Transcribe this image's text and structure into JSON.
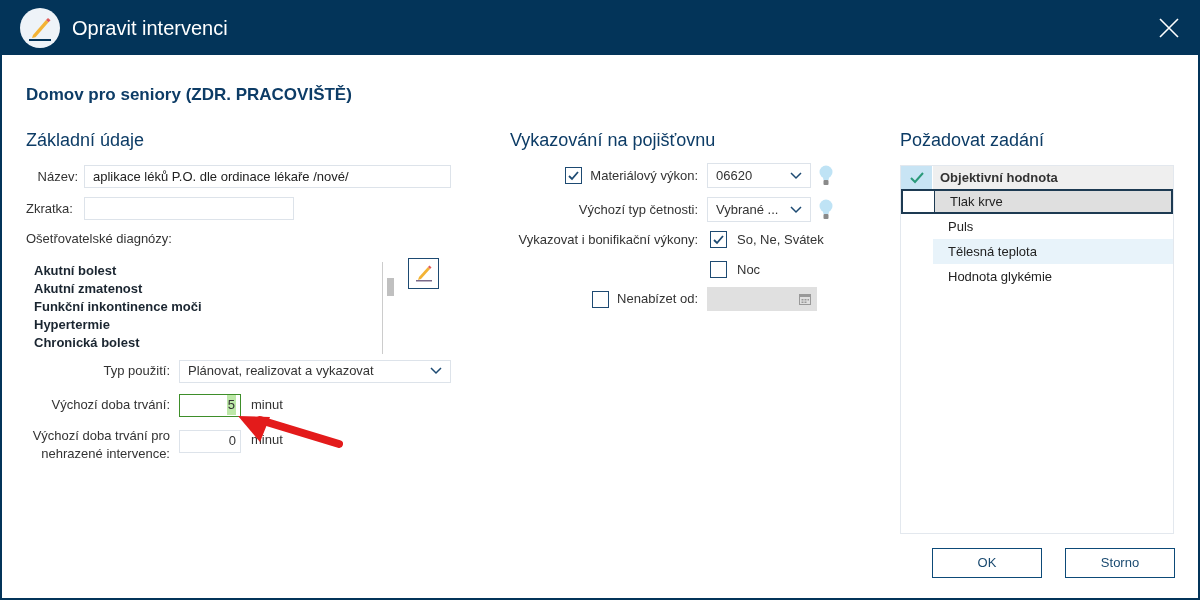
{
  "window": {
    "title": "Opravit intervenci"
  },
  "heading": "Domov pro seniory (ZDR. PRACOVIŠTĚ)",
  "basic": {
    "title": "Základní údaje",
    "name": {
      "label": "Název:",
      "value": "aplikace léků P.O. dle ordinace lékaře /nové/"
    },
    "abbrev": {
      "label": "Zkratka:"
    },
    "diagnoses_label": "Ošetřovatelské diagnózy:",
    "diagnoses": [
      "Akutní bolest",
      "Akutní zmatenost",
      "Funkční inkontinence moči",
      "Hypertermie",
      "Chronická bolest"
    ],
    "usage": {
      "label": "Typ použití:",
      "value": "Plánovat, realizovat a vykazovat"
    },
    "duration": {
      "label": "Výchozí doba trvání:",
      "value": "5",
      "unit": "minut",
      "focused": true
    },
    "duration_unpaid": {
      "label": "Výchozí doba trvání pro nehrazené intervence:",
      "value": "0",
      "unit": "minut",
      "focused": false
    }
  },
  "insurance": {
    "title": "Vykazování na pojišťovnu",
    "material": {
      "checked": true,
      "label": "Materiálový výkon:",
      "value": "06620"
    },
    "frequency": {
      "label": "Výchozí typ četnosti:",
      "value": "Vybrané ..."
    },
    "bonus_label": "Vykazovat i bonifikační výkony:",
    "bonus": [
      {
        "label": "So, Ne, Svátek",
        "checked": true
      },
      {
        "label": "Noc",
        "checked": false
      }
    ],
    "not_offer": {
      "checked": false,
      "label": "Nenabízet od:"
    }
  },
  "require": {
    "title": "Požadovat zadání",
    "header": {
      "label": "Objektivní hodnota",
      "checked": true
    },
    "rows": [
      {
        "label": "Tlak krve",
        "selected": true
      },
      {
        "label": "Puls",
        "selected": false
      },
      {
        "label": "Tělesná teplota",
        "selected": false
      },
      {
        "label": "Hodnota glykémie",
        "selected": false
      }
    ]
  },
  "buttons": [
    "OK",
    "Storno"
  ]
}
